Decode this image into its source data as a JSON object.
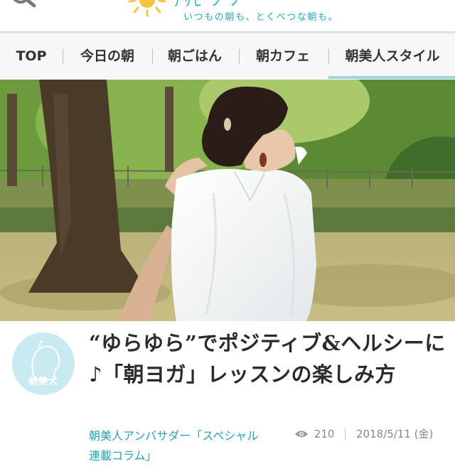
{
  "header": {
    "logo_text": "ｱｻﾋﾞｼﾞﾝ",
    "tagline": "いつもの朝も、とくべつな朝も。",
    "icons": [
      "search-icon",
      "sun-logo-icon"
    ]
  },
  "nav": {
    "items": [
      {
        "label": "TOP"
      },
      {
        "label": "今日の朝"
      },
      {
        "label": "朝ごはん"
      },
      {
        "label": "朝カフェ"
      },
      {
        "label": "朝美人スタイル",
        "active": true
      }
    ]
  },
  "article": {
    "badge_label": "朝美人",
    "title": "“ゆらゆら”でポジティブ&ヘルシーに♪「朝ヨガ」レッスンの楽しみ方",
    "category": "朝美人アンバサダー「スペシャル連載コラム」",
    "views": "210",
    "date": "2018/5/11 (金)"
  },
  "colors": {
    "accent": "#2aa9be",
    "nav_background": "#f7f7f7",
    "badge": "#c9eaf0",
    "active_underline": "#9fd3dd"
  }
}
